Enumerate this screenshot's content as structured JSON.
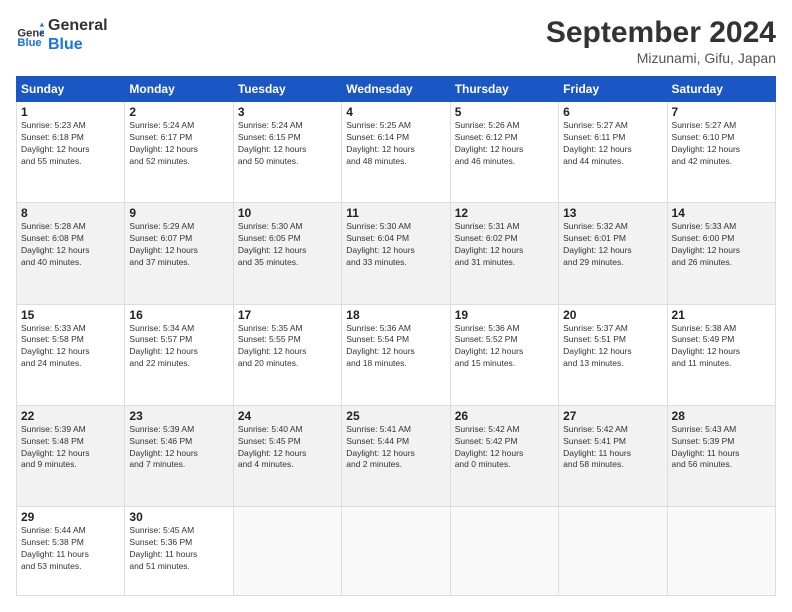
{
  "header": {
    "logo_line1": "General",
    "logo_line2": "Blue",
    "month": "September 2024",
    "location": "Mizunami, Gifu, Japan"
  },
  "weekdays": [
    "Sunday",
    "Monday",
    "Tuesday",
    "Wednesday",
    "Thursday",
    "Friday",
    "Saturday"
  ],
  "weeks": [
    [
      {
        "day": "1",
        "info": "Sunrise: 5:23 AM\nSunset: 6:18 PM\nDaylight: 12 hours\nand 55 minutes."
      },
      {
        "day": "2",
        "info": "Sunrise: 5:24 AM\nSunset: 6:17 PM\nDaylight: 12 hours\nand 52 minutes."
      },
      {
        "day": "3",
        "info": "Sunrise: 5:24 AM\nSunset: 6:15 PM\nDaylight: 12 hours\nand 50 minutes."
      },
      {
        "day": "4",
        "info": "Sunrise: 5:25 AM\nSunset: 6:14 PM\nDaylight: 12 hours\nand 48 minutes."
      },
      {
        "day": "5",
        "info": "Sunrise: 5:26 AM\nSunset: 6:12 PM\nDaylight: 12 hours\nand 46 minutes."
      },
      {
        "day": "6",
        "info": "Sunrise: 5:27 AM\nSunset: 6:11 PM\nDaylight: 12 hours\nand 44 minutes."
      },
      {
        "day": "7",
        "info": "Sunrise: 5:27 AM\nSunset: 6:10 PM\nDaylight: 12 hours\nand 42 minutes."
      }
    ],
    [
      {
        "day": "8",
        "info": "Sunrise: 5:28 AM\nSunset: 6:08 PM\nDaylight: 12 hours\nand 40 minutes."
      },
      {
        "day": "9",
        "info": "Sunrise: 5:29 AM\nSunset: 6:07 PM\nDaylight: 12 hours\nand 37 minutes."
      },
      {
        "day": "10",
        "info": "Sunrise: 5:30 AM\nSunset: 6:05 PM\nDaylight: 12 hours\nand 35 minutes."
      },
      {
        "day": "11",
        "info": "Sunrise: 5:30 AM\nSunset: 6:04 PM\nDaylight: 12 hours\nand 33 minutes."
      },
      {
        "day": "12",
        "info": "Sunrise: 5:31 AM\nSunset: 6:02 PM\nDaylight: 12 hours\nand 31 minutes."
      },
      {
        "day": "13",
        "info": "Sunrise: 5:32 AM\nSunset: 6:01 PM\nDaylight: 12 hours\nand 29 minutes."
      },
      {
        "day": "14",
        "info": "Sunrise: 5:33 AM\nSunset: 6:00 PM\nDaylight: 12 hours\nand 26 minutes."
      }
    ],
    [
      {
        "day": "15",
        "info": "Sunrise: 5:33 AM\nSunset: 5:58 PM\nDaylight: 12 hours\nand 24 minutes."
      },
      {
        "day": "16",
        "info": "Sunrise: 5:34 AM\nSunset: 5:57 PM\nDaylight: 12 hours\nand 22 minutes."
      },
      {
        "day": "17",
        "info": "Sunrise: 5:35 AM\nSunset: 5:55 PM\nDaylight: 12 hours\nand 20 minutes."
      },
      {
        "day": "18",
        "info": "Sunrise: 5:36 AM\nSunset: 5:54 PM\nDaylight: 12 hours\nand 18 minutes."
      },
      {
        "day": "19",
        "info": "Sunrise: 5:36 AM\nSunset: 5:52 PM\nDaylight: 12 hours\nand 15 minutes."
      },
      {
        "day": "20",
        "info": "Sunrise: 5:37 AM\nSunset: 5:51 PM\nDaylight: 12 hours\nand 13 minutes."
      },
      {
        "day": "21",
        "info": "Sunrise: 5:38 AM\nSunset: 5:49 PM\nDaylight: 12 hours\nand 11 minutes."
      }
    ],
    [
      {
        "day": "22",
        "info": "Sunrise: 5:39 AM\nSunset: 5:48 PM\nDaylight: 12 hours\nand 9 minutes."
      },
      {
        "day": "23",
        "info": "Sunrise: 5:39 AM\nSunset: 5:46 PM\nDaylight: 12 hours\nand 7 minutes."
      },
      {
        "day": "24",
        "info": "Sunrise: 5:40 AM\nSunset: 5:45 PM\nDaylight: 12 hours\nand 4 minutes."
      },
      {
        "day": "25",
        "info": "Sunrise: 5:41 AM\nSunset: 5:44 PM\nDaylight: 12 hours\nand 2 minutes."
      },
      {
        "day": "26",
        "info": "Sunrise: 5:42 AM\nSunset: 5:42 PM\nDaylight: 12 hours\nand 0 minutes."
      },
      {
        "day": "27",
        "info": "Sunrise: 5:42 AM\nSunset: 5:41 PM\nDaylight: 11 hours\nand 58 minutes."
      },
      {
        "day": "28",
        "info": "Sunrise: 5:43 AM\nSunset: 5:39 PM\nDaylight: 11 hours\nand 56 minutes."
      }
    ],
    [
      {
        "day": "29",
        "info": "Sunrise: 5:44 AM\nSunset: 5:38 PM\nDaylight: 11 hours\nand 53 minutes."
      },
      {
        "day": "30",
        "info": "Sunrise: 5:45 AM\nSunset: 5:36 PM\nDaylight: 11 hours\nand 51 minutes."
      },
      {
        "day": "",
        "info": ""
      },
      {
        "day": "",
        "info": ""
      },
      {
        "day": "",
        "info": ""
      },
      {
        "day": "",
        "info": ""
      },
      {
        "day": "",
        "info": ""
      }
    ]
  ]
}
